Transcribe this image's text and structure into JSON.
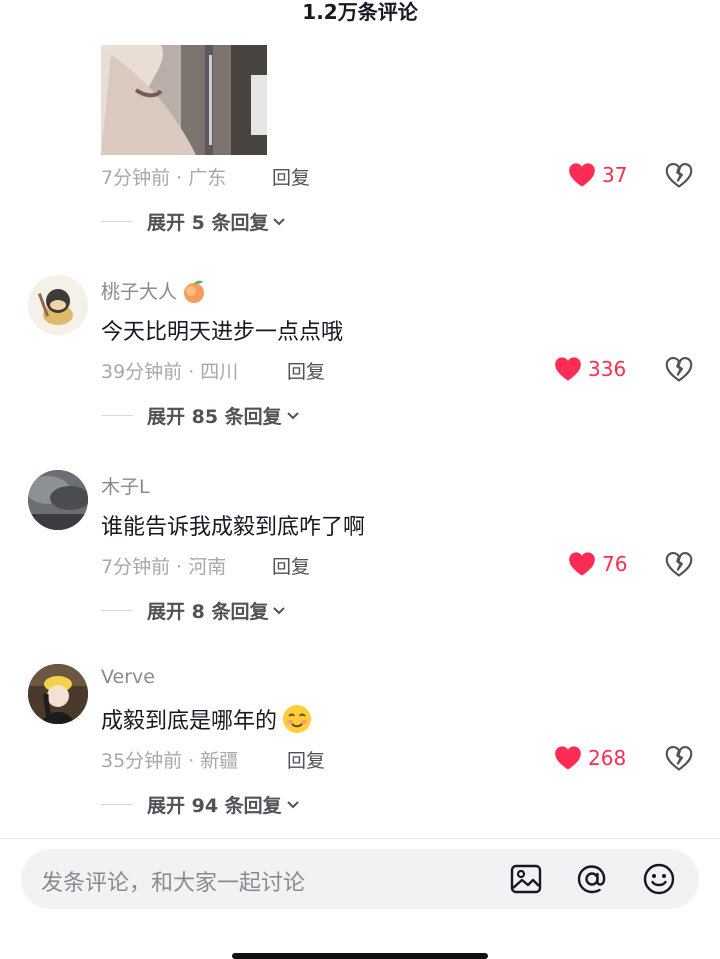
{
  "header": {
    "title": "1.2万条评论"
  },
  "comments": [
    {
      "time_location": "7分钟前 · 广东",
      "reply_label": "回复",
      "likes": "37",
      "expand_label": "展开 5 条回复"
    },
    {
      "username": "桃子大人",
      "username_emoji": "peach",
      "text": "今天比明天进步一点点哦",
      "time_location": "39分钟前 · 四川",
      "reply_label": "回复",
      "likes": "336",
      "expand_label": "展开 85 条回复"
    },
    {
      "username": "木子L",
      "text": "谁能告诉我成毅到底咋了啊",
      "time_location": "7分钟前 · 河南",
      "reply_label": "回复",
      "likes": "76",
      "expand_label": "展开 8 条回复"
    },
    {
      "username": "Verve",
      "text": "成毅到底是哪年的",
      "text_emoji": "smirk-face",
      "time_location": "35分钟前 · 新疆",
      "reply_label": "回复",
      "likes": "268",
      "expand_label": "展开 94 条回复"
    }
  ],
  "input_bar": {
    "placeholder": "发条评论，和大家一起讨论",
    "icons": [
      "image-icon",
      "at-icon",
      "emoji-icon"
    ]
  },
  "colors": {
    "like_red": "#fe2c55",
    "meta_gray": "#a7a8ad",
    "text_dark": "#161823"
  }
}
